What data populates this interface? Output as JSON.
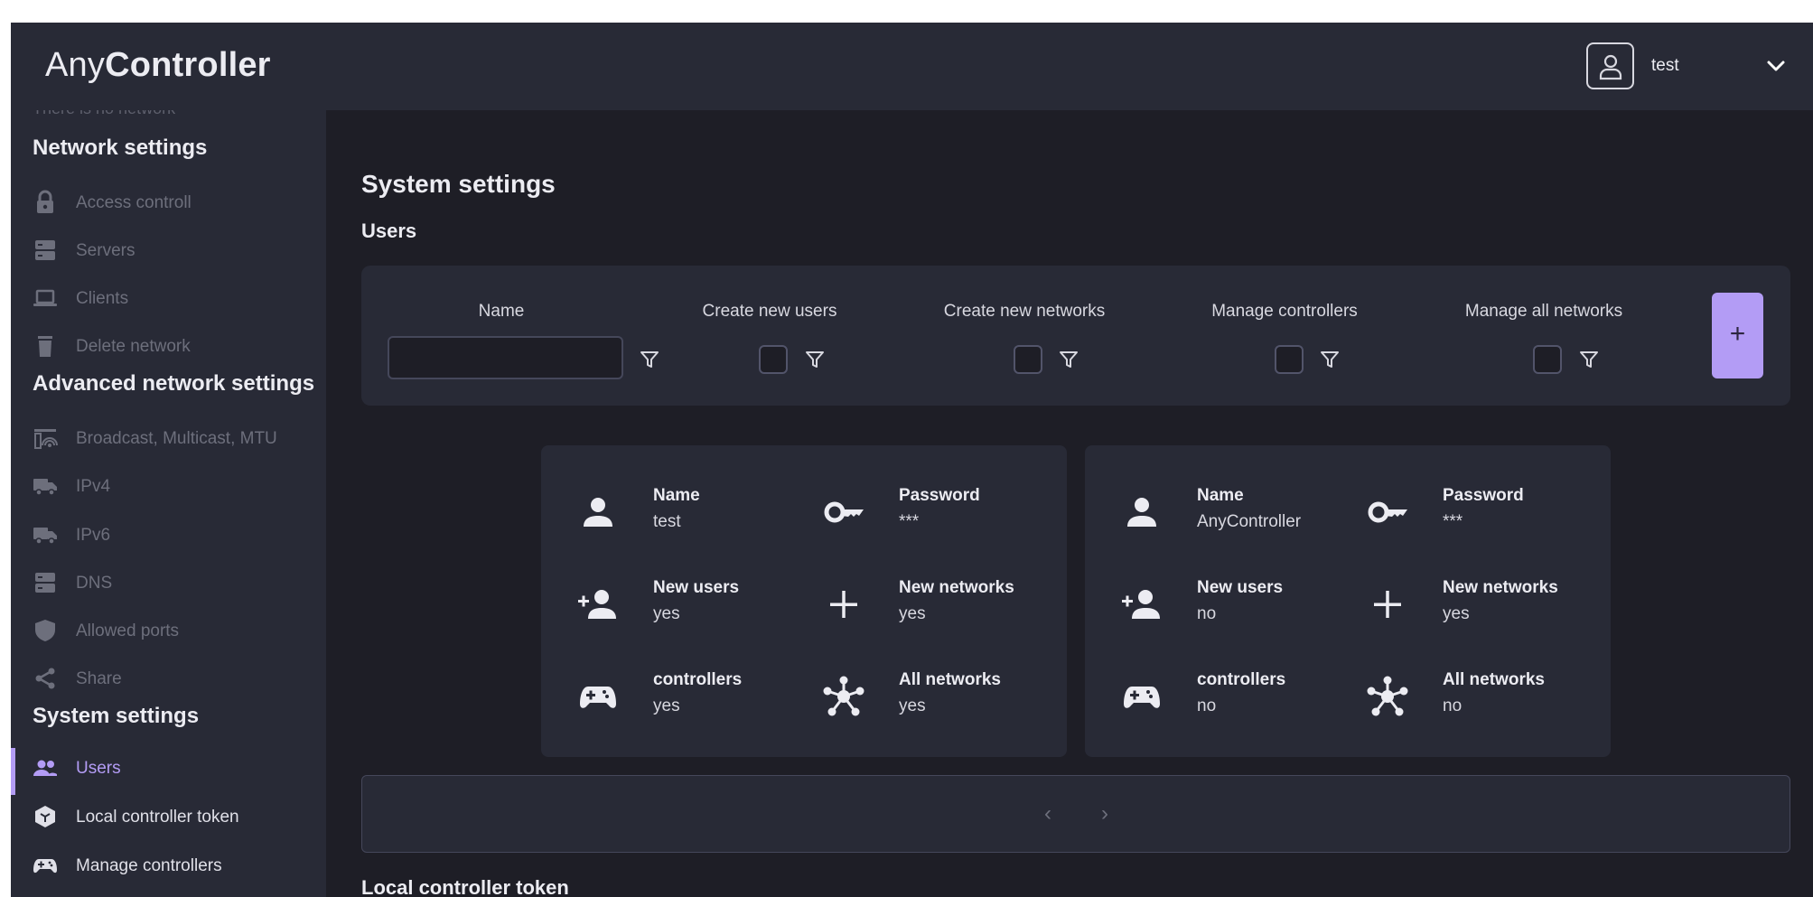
{
  "app": {
    "logo_light": "Any",
    "logo_bold": "Controller"
  },
  "header": {
    "username": "test"
  },
  "sidebar": {
    "cut_text": "There is no network",
    "network_settings": {
      "heading": "Network settings",
      "items": [
        {
          "label": "Access controll",
          "icon": "lock-icon"
        },
        {
          "label": "Servers",
          "icon": "server-icon"
        },
        {
          "label": "Clients",
          "icon": "laptop-icon"
        },
        {
          "label": "Delete network",
          "icon": "trash-icon"
        }
      ]
    },
    "advanced": {
      "heading": "Advanced network settings",
      "items": [
        {
          "label": "Broadcast, Multicast, MTU",
          "icon": "broadcast-icon"
        },
        {
          "label": "IPv4",
          "icon": "truck-icon"
        },
        {
          "label": "IPv6",
          "icon": "truck-icon"
        },
        {
          "label": "DNS",
          "icon": "server-icon"
        },
        {
          "label": "Allowed ports",
          "icon": "shield-icon"
        },
        {
          "label": "Share",
          "icon": "share-icon"
        }
      ]
    },
    "system": {
      "heading": "System settings",
      "items": [
        {
          "label": "Users",
          "icon": "users-icon",
          "active": true
        },
        {
          "label": "Local controller token",
          "icon": "cube-icon"
        },
        {
          "label": "Manage controllers",
          "icon": "gamepad-icon"
        }
      ]
    }
  },
  "main": {
    "page_title": "System settings",
    "users_title": "Users",
    "filters": {
      "columns": [
        "Name",
        "Create new users",
        "Create new networks",
        "Manage controllers",
        "Manage all networks"
      ],
      "name_value": "",
      "add_label": "+"
    },
    "users": [
      {
        "name_label": "Name",
        "name": "test",
        "password_label": "Password",
        "password": "***",
        "new_users_label": "New users",
        "new_users": "yes",
        "new_networks_label": "New networks",
        "new_networks": "yes",
        "controllers_label": "controllers",
        "controllers": "yes",
        "all_networks_label": "All networks",
        "all_networks": "yes"
      },
      {
        "name_label": "Name",
        "name": "AnyController",
        "password_label": "Password",
        "password": "***",
        "new_users_label": "New users",
        "new_users": "no",
        "new_networks_label": "New networks",
        "new_networks": "yes",
        "controllers_label": "controllers",
        "controllers": "no",
        "all_networks_label": "All networks",
        "all_networks": "no"
      }
    ],
    "pager": {
      "prev": "‹",
      "next": "›"
    },
    "token_title": "Local controller token"
  },
  "colors": {
    "accent": "#b39cf5",
    "background": "#1e1e26",
    "panel": "#282a36",
    "muted_text": "#6d6f7c"
  }
}
